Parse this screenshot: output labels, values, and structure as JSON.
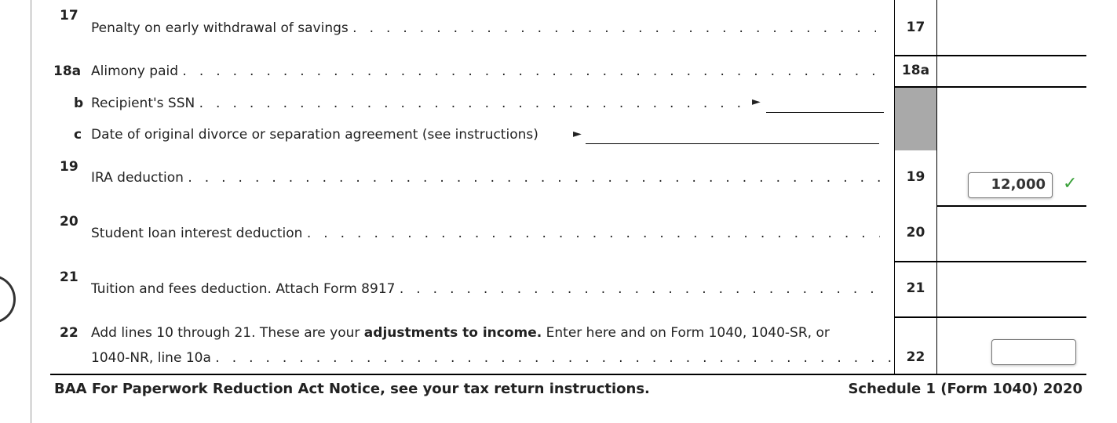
{
  "form": {
    "lines": [
      {
        "num": "17",
        "text": "Penalty on early withdrawal of savings",
        "box_label": "17",
        "value": ""
      },
      {
        "num": "18a",
        "text": "Alimony paid",
        "box_label": "18a",
        "value": ""
      },
      {
        "num": "b",
        "text": "Recipient's SSN",
        "value": ""
      },
      {
        "num": "c",
        "text": "Date of original divorce or separation agreement (see instructions)",
        "value": ""
      },
      {
        "num": "19",
        "text": "IRA deduction",
        "box_label": "19",
        "value": "12,000",
        "status_icon": "checkmark-icon"
      },
      {
        "num": "20",
        "text": "Student loan interest deduction",
        "box_label": "20",
        "value": ""
      },
      {
        "num": "21",
        "text": "Tuition and fees deduction. Attach Form 8917",
        "box_label": "21",
        "value": ""
      },
      {
        "num": "22",
        "text_pre": "Add lines 10 through 21. These are your ",
        "text_bold": "adjustments to income.",
        "text_post": " Enter here and on Form 1040, 1040-SR, or",
        "text_line2": "1040-NR, line 10a",
        "box_label": "22",
        "value": ""
      }
    ],
    "arrow": "►",
    "check": "✓",
    "dots_short": ". . . . . . . . . . . . . . . . . . . . . . . . . . . . . . . . . . . . . . . . . . . . . . . . . . . . . . . . . . . . . . . . . . . . . . . . . . . . . . . . . . . . . . . . . .",
    "footer_left": "BAA For Paperwork Reduction Act Notice, see your tax return instructions.",
    "footer_right": "Schedule 1 (Form 1040) 2020"
  },
  "colors": {
    "check": "#3aa13a",
    "shade": "#a9a9a9"
  }
}
